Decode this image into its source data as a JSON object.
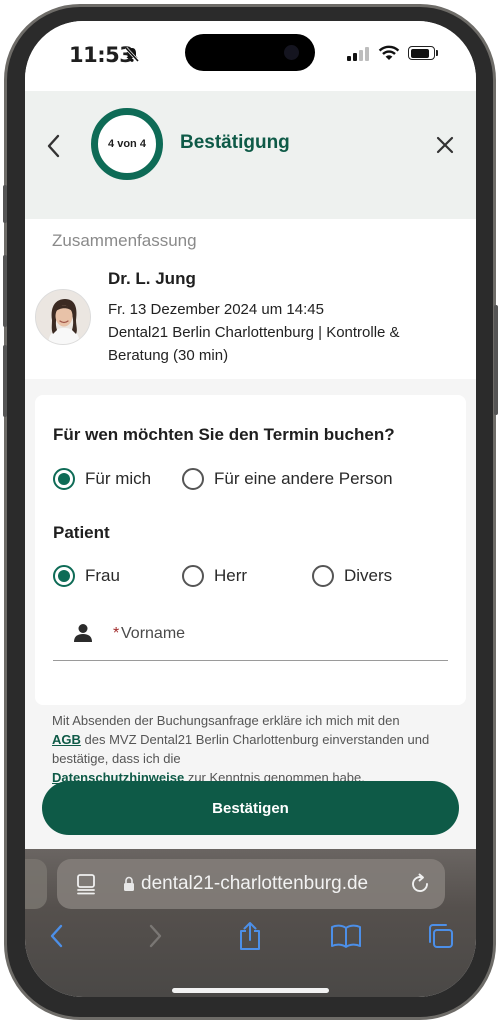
{
  "status": {
    "time": "11:53"
  },
  "header": {
    "step": "4 von 4",
    "title": "Bestätigung"
  },
  "summary": {
    "title": "Zusammenfassung",
    "doctor": "Dr. L. Jung",
    "datetime": "Fr. 13 Dezember 2024 um 14:45",
    "location_line1": "Dental21 Berlin Charlottenburg | Kontrolle &",
    "location_line2": "Beratung (30 min)"
  },
  "form": {
    "question": "Für wen möchten Sie den Termin buchen?",
    "for_whom": [
      {
        "label": "Für mich",
        "selected": true
      },
      {
        "label": "Für eine andere Person",
        "selected": false
      }
    ],
    "patient_label": "Patient",
    "salutation": [
      {
        "label": "Frau",
        "selected": true
      },
      {
        "label": "Herr",
        "selected": false
      },
      {
        "label": "Divers",
        "selected": false
      }
    ],
    "firstname_required": "*",
    "firstname_placeholder": "Vorname"
  },
  "consent": {
    "part1": "Mit Absenden der Buchungsanfrage erkläre ich mich mit den",
    "agb": "AGB",
    "part2": " des MVZ Dental21 Berlin Charlottenburg einverstanden und bestätige, dass ich die",
    "privacy": "Datenschutzhinweise",
    "part3": " zur Kenntnis genommen habe."
  },
  "cta": {
    "label": "Bestätigen"
  },
  "browser": {
    "url": "dental21-charlottenburg.de"
  },
  "colors": {
    "brand": "#0e5a47",
    "accent": "#0e6b56",
    "required": "#a12a2a"
  }
}
